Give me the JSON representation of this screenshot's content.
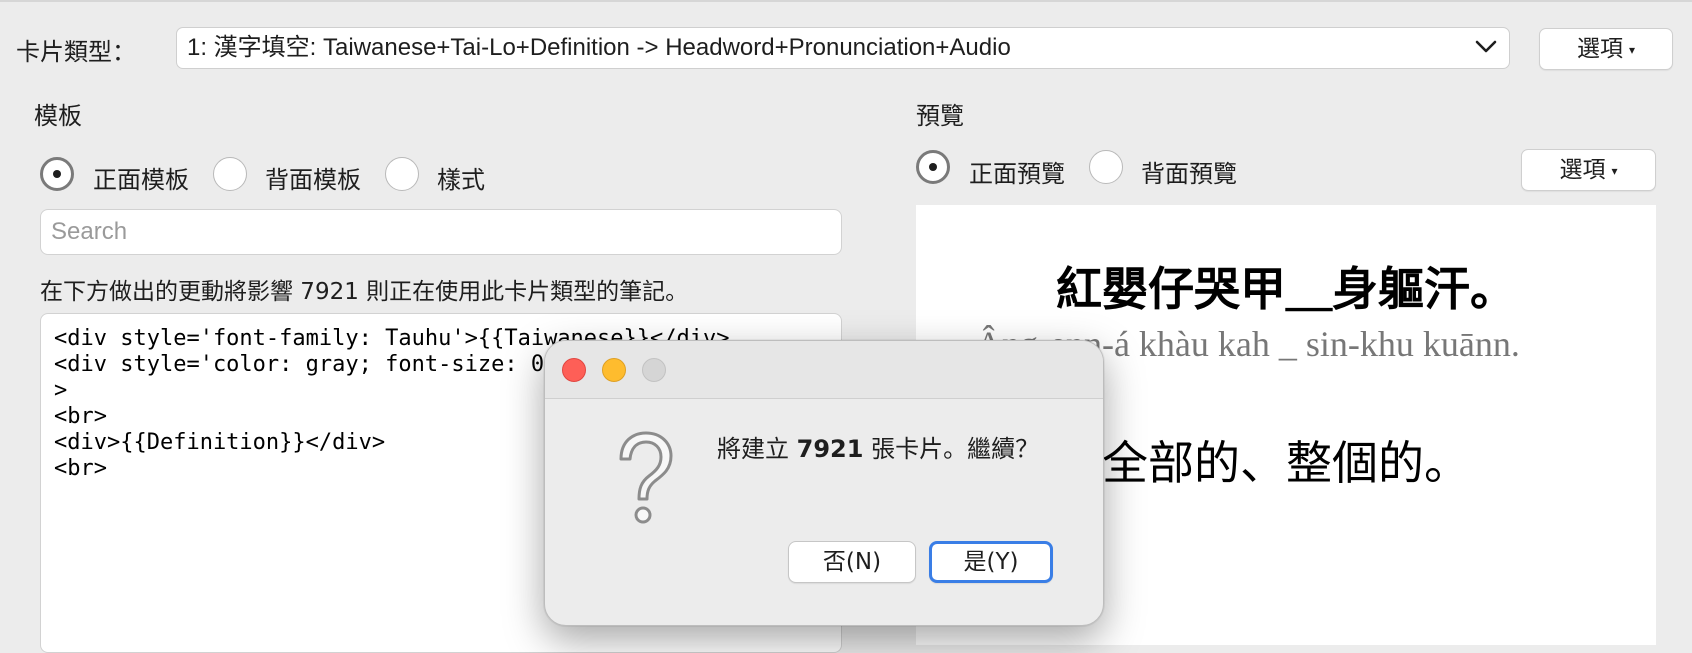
{
  "header": {
    "card_type_label": "卡片類型：",
    "card_type_value": "1: 漢字填空: Taiwanese+Tai-Lo+Definition -> Headword+Pronunciation+Audio",
    "options_label": "選項"
  },
  "template": {
    "title": "模板",
    "radios": [
      "正面模板",
      "背面模板",
      "樣式"
    ],
    "selected": "正面模板",
    "search_placeholder": "Search",
    "notice": "在下方做出的更動將影響 7921 則正在使用此卡片類型的筆記。",
    "code": "<div style='font-family: Tauhu'>{{Taiwanese}}</div>\n<div style='color: gray; font-size: 0.8em'>{{Tai-Lo}}</div>\n<br>\n<div>{{Definition}}</div>\n<br>"
  },
  "preview": {
    "title": "預覽",
    "radios": [
      "正面預覽",
      "背面預覽"
    ],
    "selected": "正面預覽",
    "options_label": "選項",
    "hanji": "紅嬰仔哭甲＿身軀汗。",
    "tailo": "Âng-enn-á khàu kah  _  sin-khu kuānn.",
    "definition": "全部的、整個的。"
  },
  "dialog": {
    "message_prefix": "將建立 ",
    "message_count": "7921",
    "message_suffix": " 張卡片。繼續？",
    "no_label": "否(N)",
    "yes_label": "是(Y)"
  },
  "colors": {
    "accent": "#3a7ee6",
    "close": "#fe5f57",
    "minimize": "#febc2e"
  }
}
